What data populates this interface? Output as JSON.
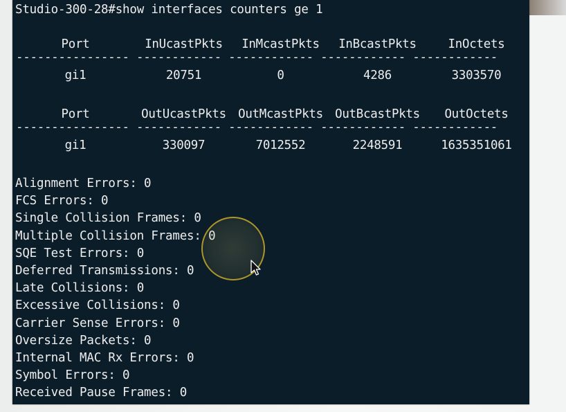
{
  "terminal": {
    "command_line": "Studio-300-28#show interfaces counters ge 1",
    "in_table": {
      "headers": [
        "Port",
        "InUcastPkts",
        "InMcastPkts",
        "InBcastPkts",
        "InOctets"
      ],
      "separator": "---------------- ------------ ------------ ------------ ------------",
      "row": [
        "gi1",
        "20751",
        "0",
        "4286",
        "3303570"
      ]
    },
    "out_table": {
      "headers": [
        "Port",
        "OutUcastPkts",
        "OutMcastPkts",
        "OutBcastPkts",
        "OutOctets"
      ],
      "separator": "---------------- ------------ ------------ ------------ ------------",
      "row": [
        "gi1",
        "330097",
        "7012552",
        "2248591",
        "1635351061"
      ]
    },
    "error_counters": [
      "Alignment Errors: 0",
      "FCS Errors: 0",
      "Single Collision Frames: 0",
      "Multiple Collision Frames: 0",
      "SQE Test Errors: 0",
      "Deferred Transmissions: 0",
      "Late Collisions: 0",
      "Excessive Collisions: 0",
      "Carrier Sense Errors: 0",
      "Oversize Packets: 0",
      "Internal MAC Rx Errors: 0",
      "Symbol Errors: 0",
      "Received Pause Frames: 0"
    ]
  },
  "colors": {
    "terminal_background": "#0c1d2a",
    "terminal_text": "#ededed",
    "cursor_halo": "#c8aa28"
  },
  "icons": {
    "pointer": "arrow-pointer-icon",
    "highlight": "cursor-highlight-icon"
  }
}
